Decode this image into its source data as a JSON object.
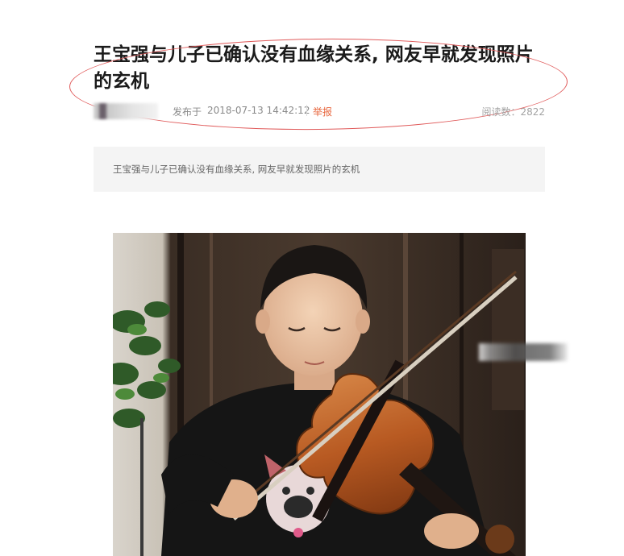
{
  "article": {
    "title": "王宝强与儿子已确认没有血缘关系, 网友早就发现照片的玄机",
    "publish_label": "发布于",
    "publish_date": "2018-07-13 14:42:12",
    "report_label": "举报",
    "read_count": "阅读数：2822",
    "summary": "王宝强与儿子已确认没有血缘关系, 网友早就发现照片的玄机"
  },
  "photo": {
    "description_icon": "boy-playing-violin-photo"
  },
  "colors": {
    "annotation_circle": "#e05a5a",
    "report_link": "#e8663d",
    "summary_bg": "#f4f4f4",
    "meta_text": "#8a8a8a"
  }
}
